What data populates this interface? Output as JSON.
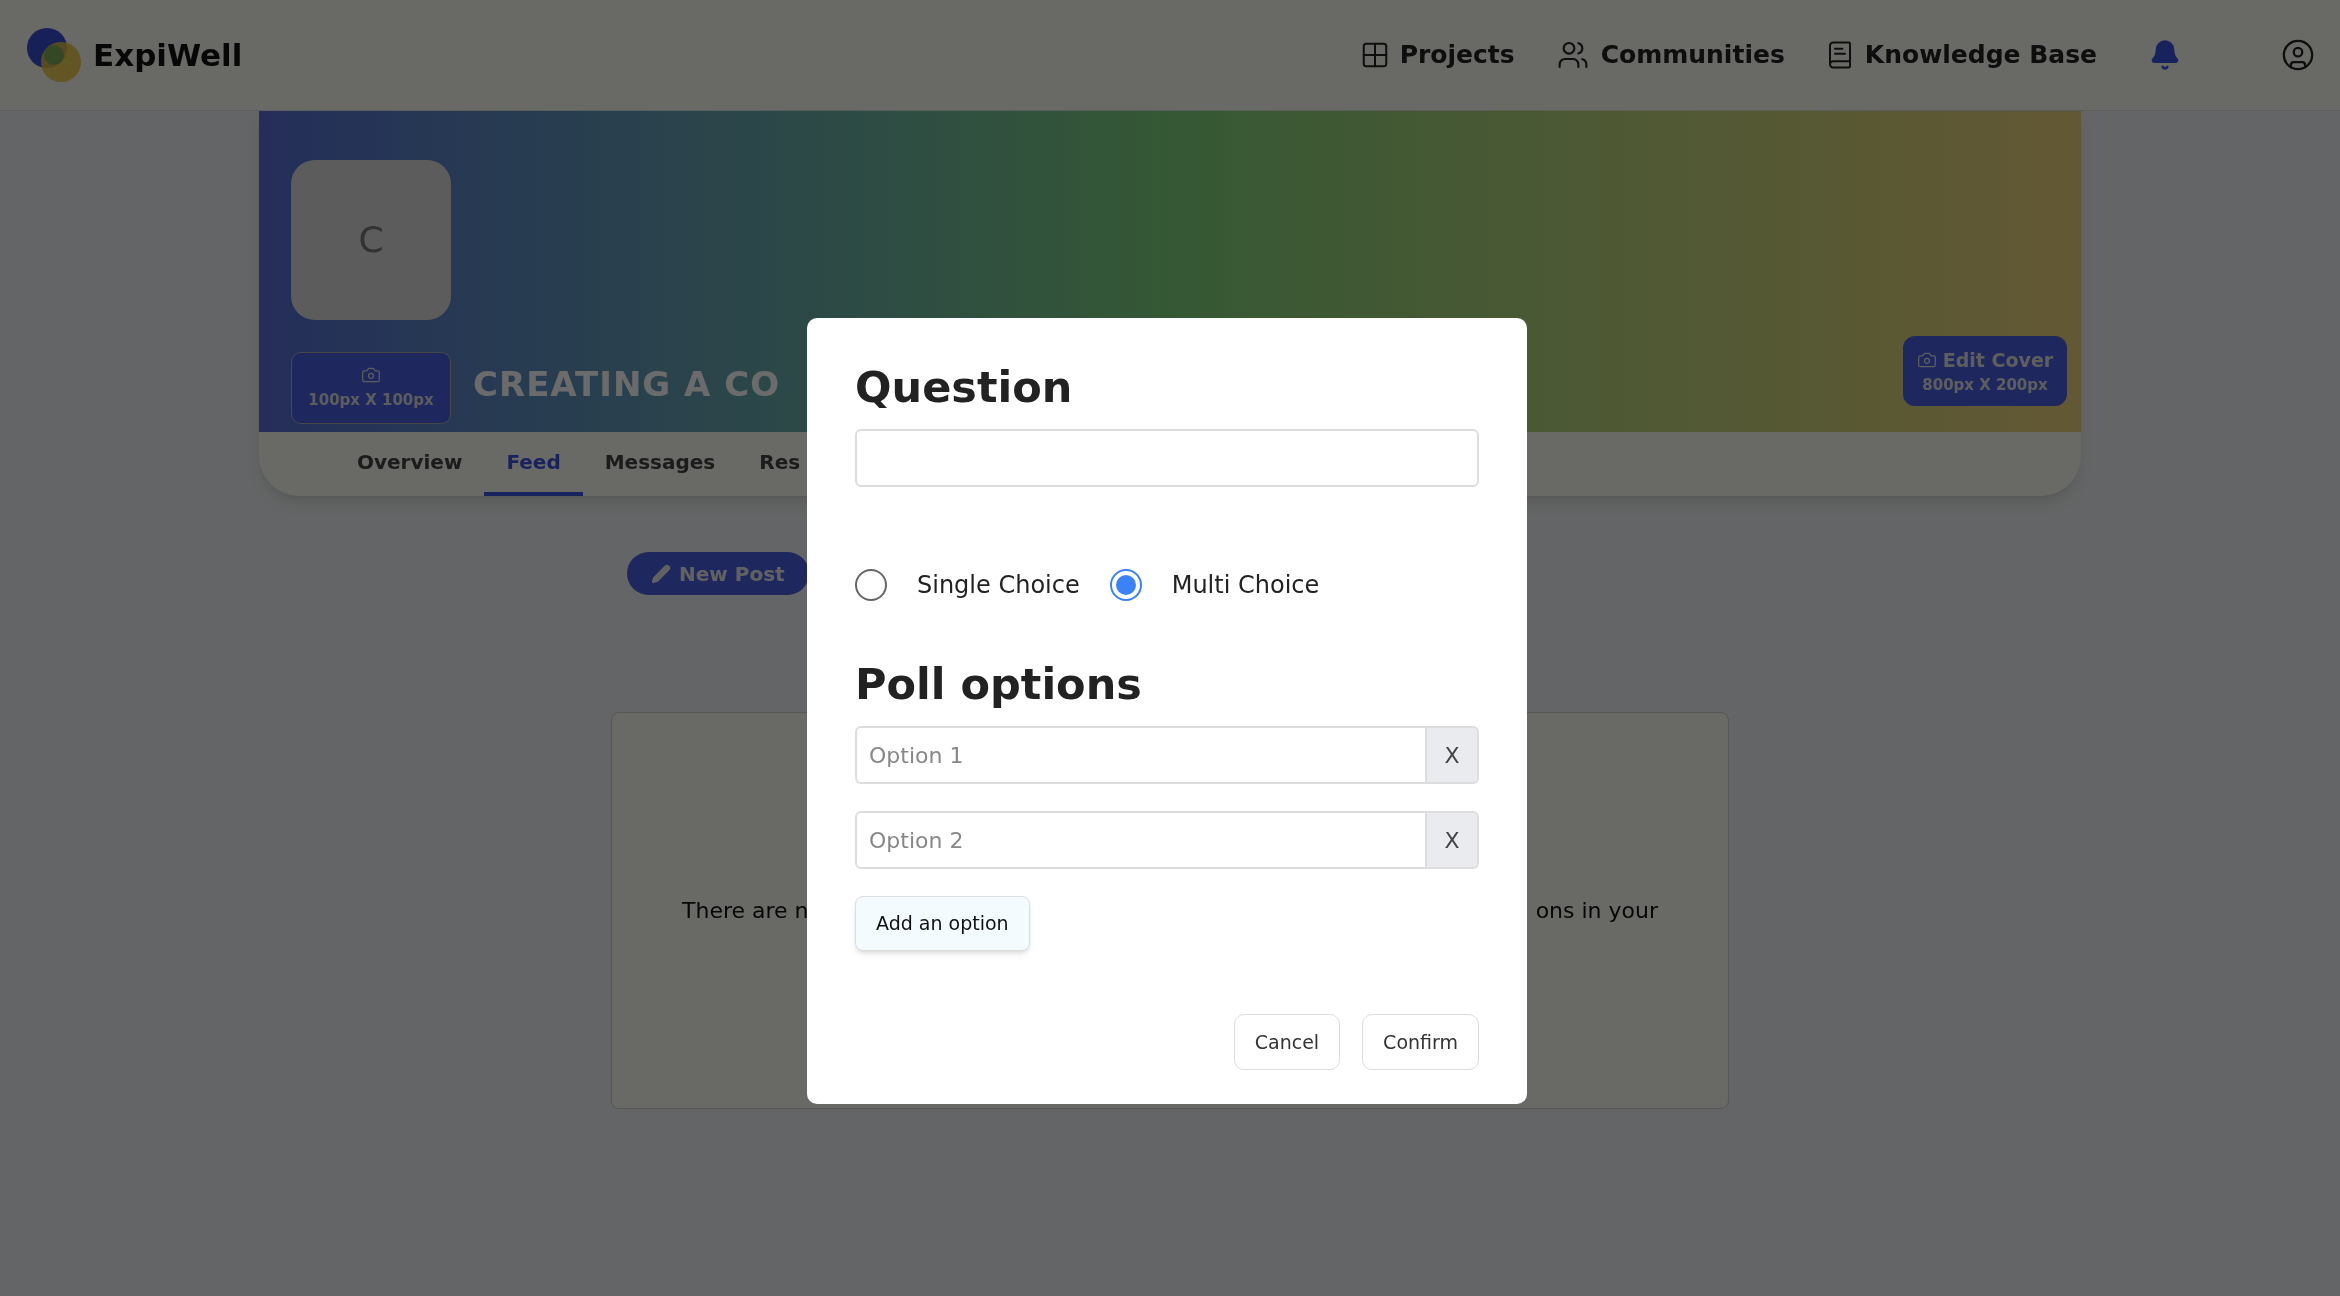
{
  "header": {
    "logo_text": "ExpiWell",
    "nav": [
      {
        "label": "Projects",
        "kind": "grid"
      },
      {
        "label": "Communities",
        "kind": "users"
      },
      {
        "label": "Knowledge Base",
        "kind": "book"
      }
    ]
  },
  "community": {
    "avatar_letter": "C",
    "avatar_size": "100px X 100px",
    "title": "CREATING A CO",
    "edit_cover": {
      "label": "Edit Cover",
      "size": "800px X 200px"
    },
    "tabs": [
      {
        "label": "Overview",
        "selected": false
      },
      {
        "label": "Feed",
        "selected": true
      },
      {
        "label": "Messages",
        "selected": false
      },
      {
        "label": "Res",
        "selected": false
      }
    ]
  },
  "new_post": "New Post",
  "empty_state": {
    "text_left": "There are n",
    "text_right": "ons in your"
  },
  "dialog": {
    "question_label": "Question",
    "choice_types": [
      {
        "label": "Single Choice",
        "selected": false
      },
      {
        "label": "Multi Choice",
        "selected": true
      }
    ],
    "poll_options_label": "Poll options",
    "options": [
      {
        "placeholder": "Option 1",
        "remove": "X"
      },
      {
        "placeholder": "Option 2",
        "remove": "X"
      }
    ],
    "add_option": "Add an option",
    "buttons": [
      {
        "label": "Cancel"
      },
      {
        "label": "Confirm"
      }
    ]
  }
}
